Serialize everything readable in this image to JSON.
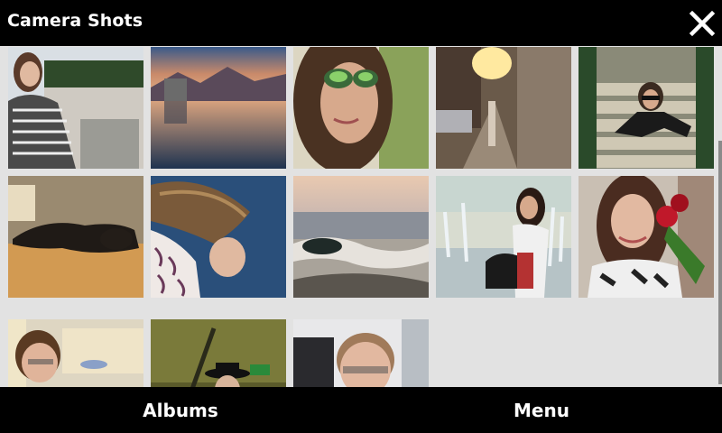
{
  "header": {
    "title": "Camera Shots",
    "close_icon": "close-icon"
  },
  "gallery": {
    "thumbnails": [
      {
        "name": "photo-woman-checkered-coat"
      },
      {
        "name": "photo-mountain-lake-sunset"
      },
      {
        "name": "photo-woman-mirrored-sunglasses"
      },
      {
        "name": "photo-street-sunset"
      },
      {
        "name": "photo-woman-on-stairs"
      },
      {
        "name": "photo-dog-on-floor"
      },
      {
        "name": "photo-woman-hair-flip"
      },
      {
        "name": "photo-ocean-waves-rock"
      },
      {
        "name": "photo-woman-fountain-handbag"
      },
      {
        "name": "photo-woman-red-roses"
      },
      {
        "name": "photo-man-glasses-indoor"
      },
      {
        "name": "photo-man-microphone"
      },
      {
        "name": "photo-man-office"
      }
    ]
  },
  "footer": {
    "left_softkey": "Albums",
    "right_softkey": "Menu"
  },
  "colors": {
    "bar_bg": "#000000",
    "grid_bg": "#e2e2e2",
    "text": "#ffffff"
  }
}
